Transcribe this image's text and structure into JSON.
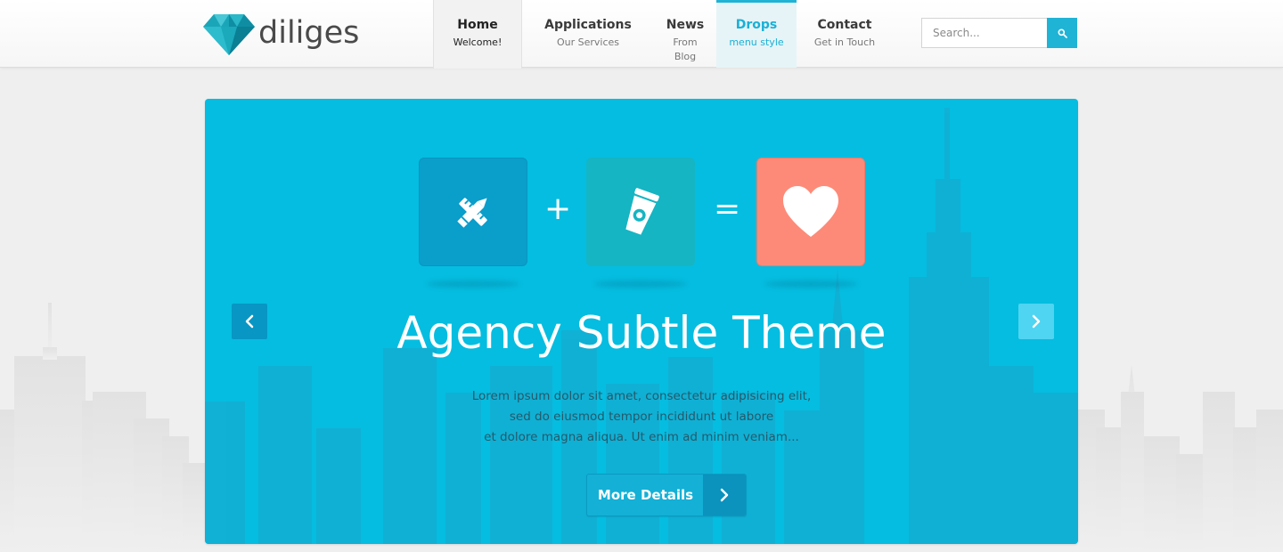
{
  "brand": {
    "name": "diliges",
    "logo_icon": "diamond-icon"
  },
  "nav": {
    "items": [
      {
        "title": "Home",
        "subtitle": "Welcome!"
      },
      {
        "title": "Applications",
        "subtitle": "Our Services"
      },
      {
        "title": "News",
        "subtitle": "From Blog"
      },
      {
        "title": "Drops",
        "subtitle": "menu style"
      },
      {
        "title": "Contact",
        "subtitle": "Get in Touch"
      }
    ]
  },
  "search": {
    "placeholder": "Search...",
    "icon": "search-icon"
  },
  "slider": {
    "equation": {
      "tiles": [
        {
          "icon": "ruler-pencil-icon",
          "color": "#0a9ecb"
        },
        {
          "icon": "coffee-cup-icon",
          "color": "#15b5c3"
        },
        {
          "icon": "heart-icon",
          "color": "#fd8a78"
        }
      ],
      "plus": "+",
      "equals": "="
    },
    "headline": "Agency Subtle Theme",
    "description": [
      "Lorem ipsum dolor sit amet, consectetur adipisicing elit,",
      "sed do eiusmod tempor incididunt ut labore",
      "et dolore magna aliqua. Ut enim ad minim veniam..."
    ],
    "cta_label": "More Details",
    "prev_icon": "chevron-left-icon",
    "next_icon": "chevron-right-icon"
  },
  "colors": {
    "accent": "#1fb3d6",
    "slider_bg": "#05bde0",
    "heart_tile": "#fd8a78",
    "page_bg": "#efefef"
  }
}
